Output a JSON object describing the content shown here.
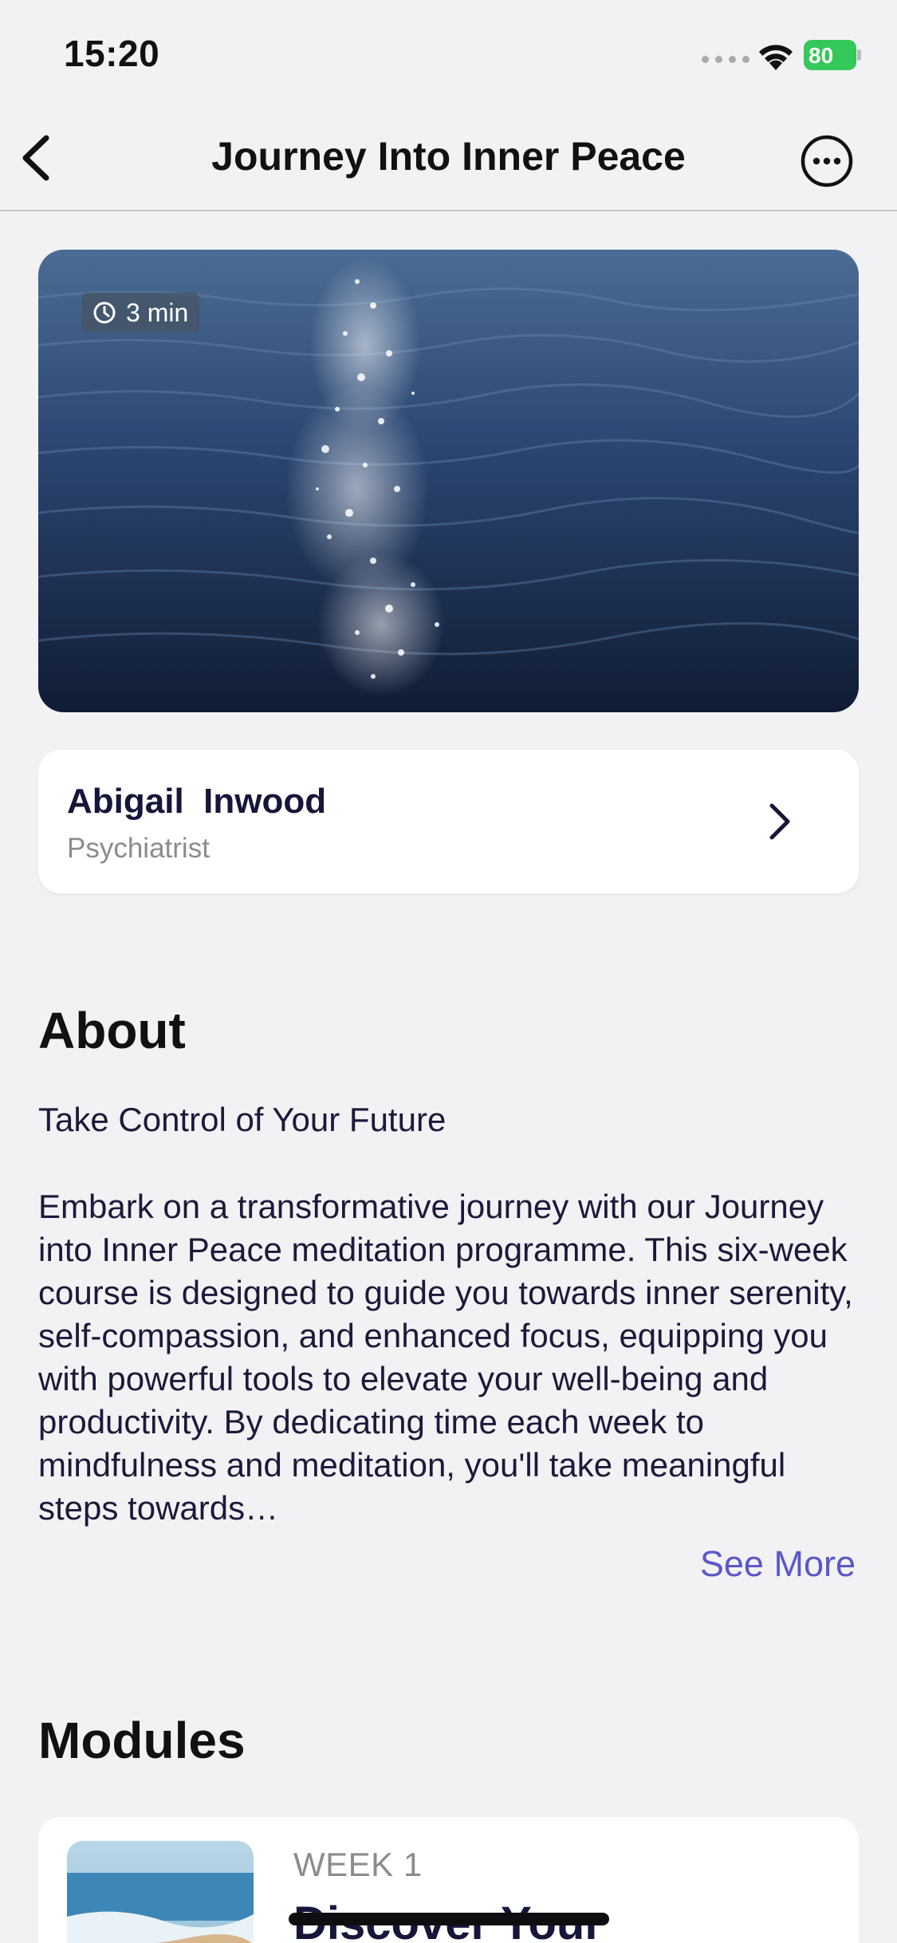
{
  "status_bar": {
    "time": "15:20",
    "battery": "80"
  },
  "nav": {
    "title": "Journey Into Inner Peace",
    "back_icon": "chevron-left-icon",
    "more_icon": "ellipsis-circle-icon"
  },
  "hero": {
    "duration": "3 min",
    "duration_icon": "timer-icon"
  },
  "author": {
    "name": "Abigail  Inwood",
    "role": "Psychiatrist"
  },
  "about": {
    "title": "About",
    "subtitle": "Take Control of Your Future",
    "body": "Embark on a transformative journey with our Journey into Inner Peace meditation programme. This six-week course is designed to guide you towards inner serenity, self-compassion, and enhanced focus, equipping you with powerful tools to elevate your well-being and productivity. By dedicating time each week to mindfulness and meditation, you'll take meaningful steps towards…",
    "see_more": "See More"
  },
  "modules": {
    "title": "Modules",
    "items": [
      {
        "week": "WEEK 1",
        "title": "Discover Your"
      }
    ]
  },
  "colors": {
    "accent": "#5b57c9",
    "battery": "#34c759",
    "card": "#ffffff",
    "background": "#f2f2f5"
  }
}
